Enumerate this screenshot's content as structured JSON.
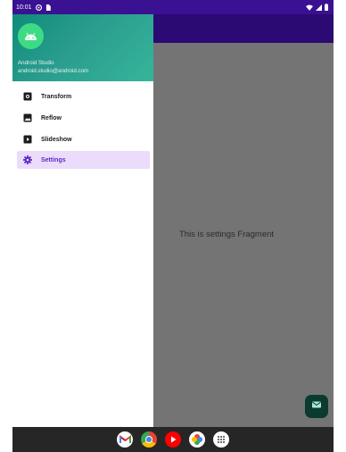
{
  "status_bar": {
    "time": "10:01"
  },
  "drawer": {
    "header": {
      "name": "Android Studio",
      "email": "android.studio@android.com"
    },
    "items": [
      {
        "label": "Transform",
        "icon": "camera-icon",
        "active": false
      },
      {
        "label": "Reflow",
        "icon": "image-icon",
        "active": false
      },
      {
        "label": "Slideshow",
        "icon": "slideshow-icon",
        "active": false
      },
      {
        "label": "Settings",
        "icon": "settings-gear-icon",
        "active": true
      }
    ]
  },
  "content": {
    "fragment_text": "This is settings Fragment"
  },
  "fab": {
    "icon": "email-icon"
  },
  "dock": {
    "apps": [
      "gmail-icon",
      "chrome-icon",
      "youtube-icon",
      "photos-icon",
      "app-drawer-icon"
    ]
  },
  "colors": {
    "primary": "#3a1192",
    "accent_active": "#5b2bc4",
    "active_bg": "#ebdcfb",
    "header_green": "#1a9c85",
    "fab": "#0b3b30"
  }
}
